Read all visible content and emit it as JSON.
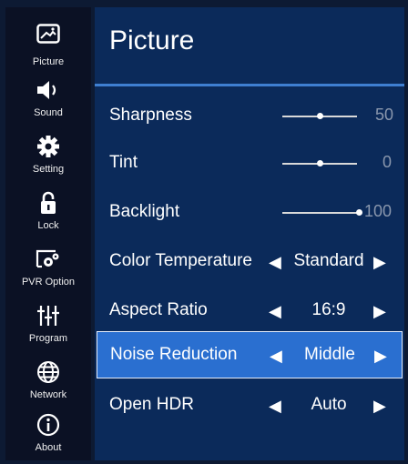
{
  "sidebar": {
    "items": [
      {
        "label": "Picture",
        "icon": "picture-icon"
      },
      {
        "label": "Sound",
        "icon": "speaker-icon"
      },
      {
        "label": "Setting",
        "icon": "gear-icon"
      },
      {
        "label": "Lock",
        "icon": "lock-icon"
      },
      {
        "label": "PVR Option",
        "icon": "pvr-icon"
      },
      {
        "label": "Program",
        "icon": "program-icon"
      },
      {
        "label": "Network",
        "icon": "globe-icon"
      },
      {
        "label": "About",
        "icon": "info-icon"
      }
    ]
  },
  "main": {
    "title": "Picture",
    "rows": [
      {
        "label": "Sharpness",
        "type": "slider",
        "value": "50",
        "level": 0.5
      },
      {
        "label": "Tint",
        "type": "slider",
        "value": "0",
        "level": 0.5
      },
      {
        "label": "Backlight",
        "type": "slider",
        "value": "100",
        "level": 1.0
      },
      {
        "label": "Color Temperature",
        "type": "choice",
        "value": "Standard"
      },
      {
        "label": "Aspect Ratio",
        "type": "choice",
        "value": "16:9"
      },
      {
        "label": "Noise Reduction",
        "type": "choice",
        "value": "Middle",
        "selected": true
      },
      {
        "label": "Open HDR",
        "type": "choice",
        "value": "Auto"
      }
    ]
  },
  "colors": {
    "panel": "#0b2a5a",
    "sidebar": "#0b1124",
    "highlight": "#2a6fd0",
    "accent_rule": "#3f7fd1"
  }
}
